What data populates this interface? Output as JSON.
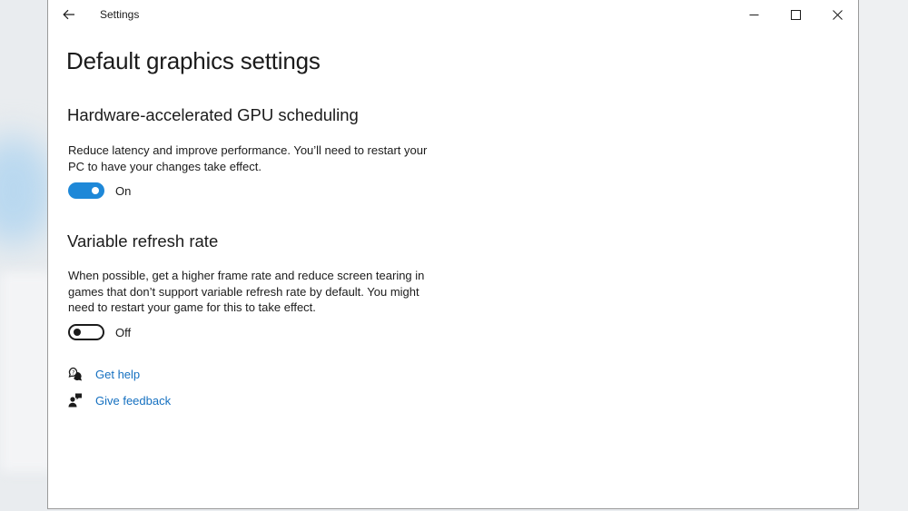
{
  "window": {
    "title": "Settings"
  },
  "page": {
    "title": "Default graphics settings"
  },
  "gpu_scheduling": {
    "title": "Hardware-accelerated GPU scheduling",
    "description": "Reduce latency and improve performance. You’ll need to restart your PC to have your changes take effect.",
    "toggle_state": "On"
  },
  "variable_refresh": {
    "title": "Variable refresh rate",
    "description": "When possible, get a higher frame rate and reduce screen tearing in games that don’t support variable refresh rate by default. You might need to restart your game for this to take effect.",
    "toggle_state": "Off"
  },
  "links": {
    "help": "Get help",
    "feedback": "Give feedback"
  },
  "icons": {
    "back": "back-arrow-icon",
    "minimize": "minimize-icon",
    "maximize": "maximize-icon",
    "close": "close-icon",
    "help": "chat-help-icon",
    "feedback": "feedback-person-icon"
  },
  "colors": {
    "accent": "#1e88d8",
    "link": "#1570c0",
    "text": "#1b1b1b",
    "background": "#ffffff"
  }
}
